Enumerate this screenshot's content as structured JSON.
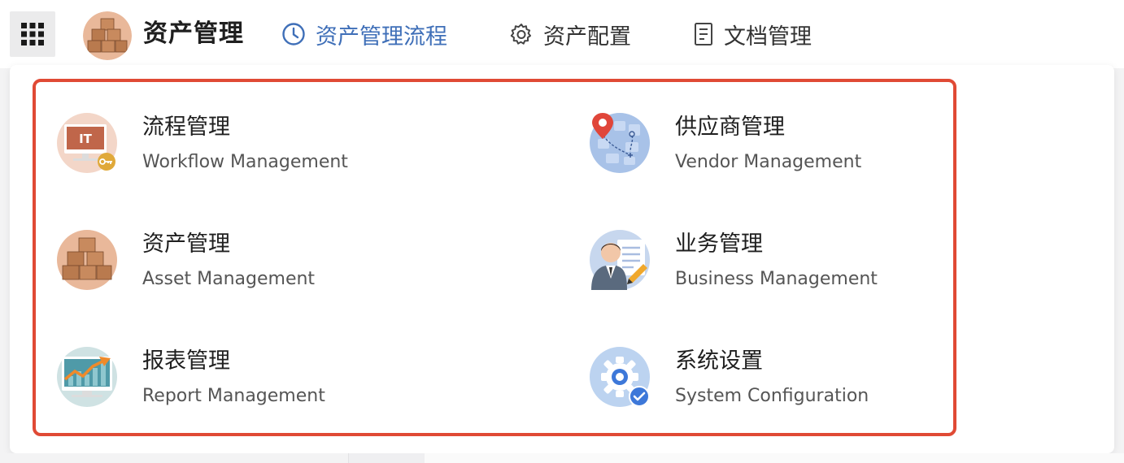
{
  "header": {
    "title": "资产管理",
    "nav": [
      {
        "label": "资产管理流程",
        "icon": "clock-icon",
        "active": true
      },
      {
        "label": "资产配置",
        "icon": "gear-icon",
        "active": false
      },
      {
        "label": "文档管理",
        "icon": "document-icon",
        "active": false
      }
    ],
    "accent_color": "#3f6fb8"
  },
  "menu": {
    "highlight_color": "#e04a35",
    "items": [
      {
        "title": "流程管理",
        "subtitle": "Workflow Management",
        "icon": "it-monitor-key-icon"
      },
      {
        "title": "供应商管理",
        "subtitle": "Vendor Management",
        "icon": "map-pin-icon"
      },
      {
        "title": "资产管理",
        "subtitle": "Asset Management",
        "icon": "boxes-icon"
      },
      {
        "title": "业务管理",
        "subtitle": "Business Management",
        "icon": "businessman-icon"
      },
      {
        "title": "报表管理",
        "subtitle": "Report Management",
        "icon": "chart-monitor-icon"
      },
      {
        "title": "系统设置",
        "subtitle": "System Configuration",
        "icon": "settings-check-icon"
      }
    ]
  }
}
